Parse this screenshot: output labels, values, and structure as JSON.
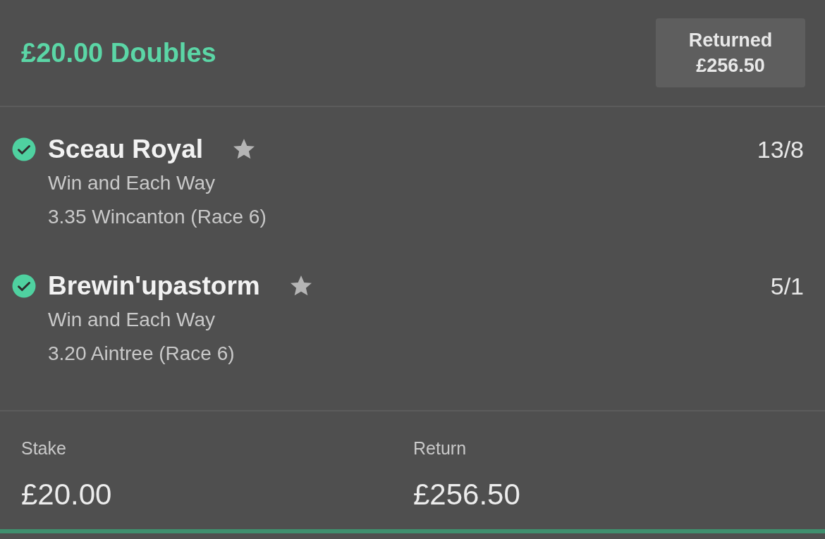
{
  "bet": {
    "title": "£20.00 Doubles",
    "status_label": "Returned",
    "status_amount": "£256.50"
  },
  "selections": [
    {
      "name": "Sceau Royal",
      "won": true,
      "market": "Win and Each Way",
      "event": "3.35 Wincanton (Race 6)",
      "odds": "13/8"
    },
    {
      "name": "Brewin'upastorm",
      "won": true,
      "market": "Win and Each Way",
      "event": "3.20 Aintree (Race 6)",
      "odds": "5/1"
    }
  ],
  "summary": {
    "stake_label": "Stake",
    "stake": "£20.00",
    "return_label": "Return",
    "return": "£256.50"
  }
}
